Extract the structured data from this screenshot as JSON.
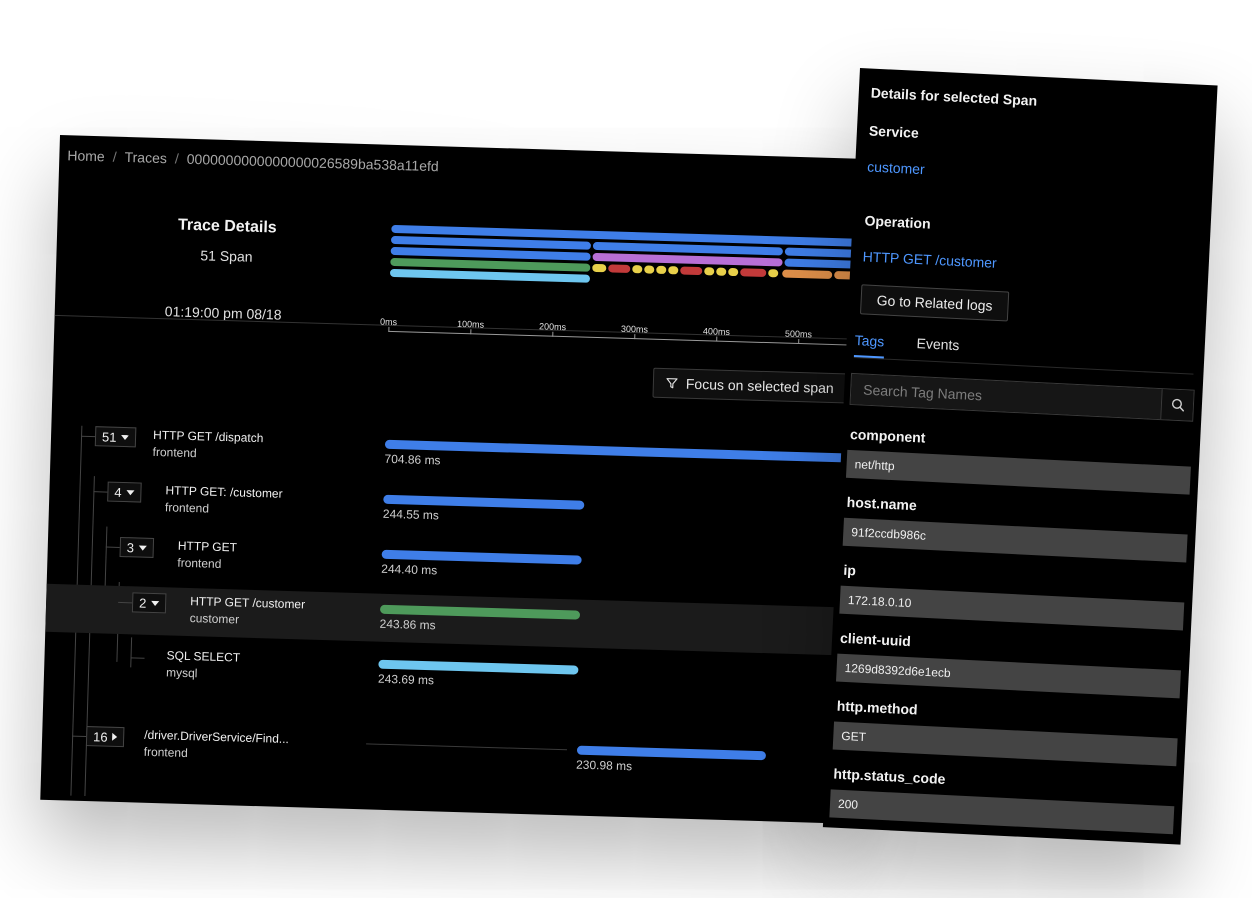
{
  "breadcrumb": {
    "home": "Home",
    "traces": "Traces",
    "trace_id": "0000000000000000026589ba538a11efd",
    "separator": "/"
  },
  "trace_header": {
    "title": "Trace Details",
    "span_count": "51 Span",
    "timestamp": "01:19:00 pm 08/18"
  },
  "timeline": {
    "ticks": [
      "0ms",
      "100ms",
      "200ms",
      "300ms",
      "400ms",
      "500ms"
    ]
  },
  "focus_button": {
    "label": "Focus on selected span",
    "icon": "funnel-icon"
  },
  "colors": {
    "blue": "#3f7ee8",
    "green": "#4e9a5b",
    "light_blue": "#6ec6ef",
    "purple": "#b86fd6",
    "yellow": "#e8d04a",
    "red": "#c23a3a",
    "orange": "#e0904a",
    "link": "#4e97ff"
  },
  "spans": [
    {
      "count": "51",
      "expanded": true,
      "name": "HTTP GET /dispatch",
      "service": "frontend",
      "duration": "704.86 ms",
      "start_ms": 0,
      "duration_ms": 704.86,
      "color": "blue",
      "selected": false
    },
    {
      "count": "4",
      "expanded": true,
      "name": "HTTP GET: /customer",
      "service": "frontend",
      "duration": "244.55 ms",
      "start_ms": 0,
      "duration_ms": 244.55,
      "color": "blue",
      "selected": false
    },
    {
      "count": "3",
      "expanded": true,
      "name": "HTTP GET",
      "service": "frontend",
      "duration": "244.40 ms",
      "start_ms": 0,
      "duration_ms": 244.4,
      "color": "blue",
      "selected": false
    },
    {
      "count": "2",
      "expanded": true,
      "name": "HTTP GET /customer",
      "service": "customer",
      "duration": "243.86 ms",
      "start_ms": 0,
      "duration_ms": 243.86,
      "color": "green",
      "selected": true
    },
    {
      "count": "",
      "expanded": false,
      "name": "SQL SELECT",
      "service": "mysql",
      "duration": "243.69 ms",
      "start_ms": 0,
      "duration_ms": 243.69,
      "color": "light_blue",
      "selected": false
    },
    {
      "count": "16",
      "expanded": false,
      "name": "/driver.DriverService/Find...",
      "service": "frontend",
      "duration": "230.98 ms",
      "start_ms": 244.6,
      "duration_ms": 230.98,
      "color": "blue",
      "selected": false
    }
  ],
  "details": {
    "title": "Details for selected Span",
    "service_label": "Service",
    "service_value": "customer",
    "operation_label": "Operation",
    "operation_value": "HTTP GET /customer",
    "related_logs_button": "Go to Related logs",
    "tabs": [
      "Tags",
      "Events"
    ],
    "active_tab": "Tags",
    "search_placeholder": "Search Tag Names",
    "search_icon": "search-icon",
    "tags": [
      {
        "key": "component",
        "value": "net/http"
      },
      {
        "key": "host.name",
        "value": "91f2ccdb986c"
      },
      {
        "key": "ip",
        "value": "172.18.0.10"
      },
      {
        "key": "client-uuid",
        "value": "1269d8392d6e1ecb"
      },
      {
        "key": "http.method",
        "value": "GET"
      },
      {
        "key": "http.status_code",
        "value": "200"
      }
    ]
  }
}
